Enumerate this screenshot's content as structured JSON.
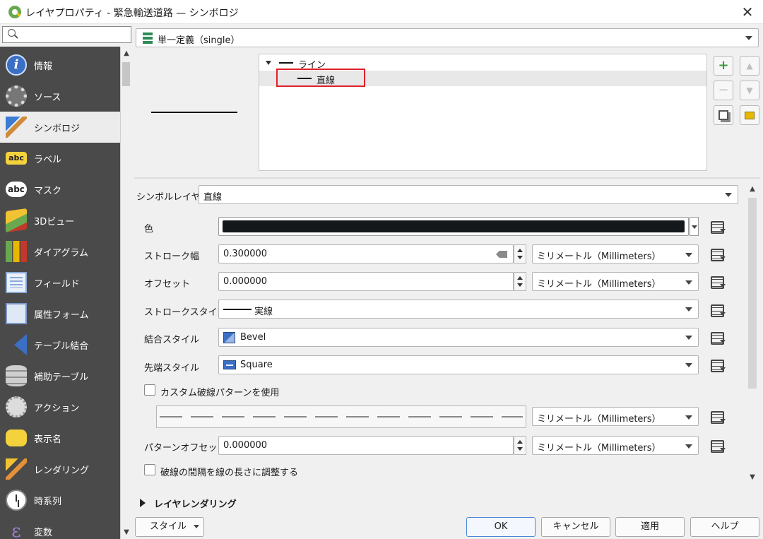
{
  "window": {
    "title": "レイヤプロパティ - 緊急輸送道路 — シンボロジ",
    "close_icon": "close-icon"
  },
  "search": {
    "placeholder": "",
    "icon": "search-icon"
  },
  "sidebar": {
    "items": [
      {
        "label": "情報",
        "icon": "info-icon"
      },
      {
        "label": "ソース",
        "icon": "source-wrench-icon"
      },
      {
        "label": "シンボロジ",
        "icon": "symbology-brush-icon",
        "active": true
      },
      {
        "label": "ラベル",
        "icon": "labels-abc-icon",
        "icon_text": "abc"
      },
      {
        "label": "マスク",
        "icon": "mask-abc-icon",
        "icon_text": "abc"
      },
      {
        "label": "3Dビュー",
        "icon": "3d-cube-icon"
      },
      {
        "label": "ダイアグラム",
        "icon": "diagram-icon"
      },
      {
        "label": "フィールド",
        "icon": "fields-icon"
      },
      {
        "label": "属性フォーム",
        "icon": "attribute-form-icon"
      },
      {
        "label": "テーブル結合",
        "icon": "join-icon"
      },
      {
        "label": "補助テーブル",
        "icon": "auxiliary-storage-icon"
      },
      {
        "label": "アクション",
        "icon": "actions-icon"
      },
      {
        "label": "表示名",
        "icon": "display-chat-icon"
      },
      {
        "label": "レンダリング",
        "icon": "rendering-brush-icon"
      },
      {
        "label": "時系列",
        "icon": "temporal-clock-icon"
      },
      {
        "label": "変数",
        "icon": "variables-epsilon-icon",
        "icon_text": "ε"
      }
    ]
  },
  "renderer": {
    "selected": "単一定義（single）"
  },
  "symbol_tree": {
    "items": [
      {
        "label": "ライン",
        "level": 0,
        "expanded": true
      },
      {
        "label": "直線",
        "level": 1,
        "selected": true
      }
    ],
    "buttons": {
      "add": "+",
      "remove": "−",
      "move_up": "▲",
      "move_down": "▼",
      "duplicate_icon": "duplicate-icon",
      "lock_icon": "lock-icon"
    },
    "highlight_color": "#e0202a"
  },
  "layer_type": {
    "label": "シンボルレイヤ型",
    "value": "直線"
  },
  "properties": {
    "color": {
      "label": "色",
      "value": "#15181b"
    },
    "stroke_width": {
      "label": "ストローク幅",
      "value": "0.300000",
      "unit": "ミリメートル（Millimeters）"
    },
    "offset": {
      "label": "オフセット",
      "value": "0.000000",
      "unit": "ミリメートル（Millimeters）"
    },
    "stroke_style": {
      "label": "ストロークスタイル",
      "value": "実線"
    },
    "join_style": {
      "label": "結合スタイル",
      "value": "Bevel"
    },
    "cap_style": {
      "label": "先端スタイル",
      "value": "Square"
    },
    "custom_dash": {
      "label": "カスタム破線パターンを使用",
      "checked": false,
      "unit": "ミリメートル（Millimeters）"
    },
    "pattern_offset": {
      "label": "パターンオフセット",
      "value": "0.000000",
      "unit": "ミリメートル（Millimeters）"
    },
    "align_dash": {
      "label": "破線の間隔を線の長さに調整する",
      "checked": false
    }
  },
  "section": {
    "layer_rendering": "レイヤレンダリング"
  },
  "footer": {
    "style": "スタイル",
    "ok": "OK",
    "cancel": "キャンセル",
    "apply": "適用",
    "help": "ヘルプ"
  }
}
